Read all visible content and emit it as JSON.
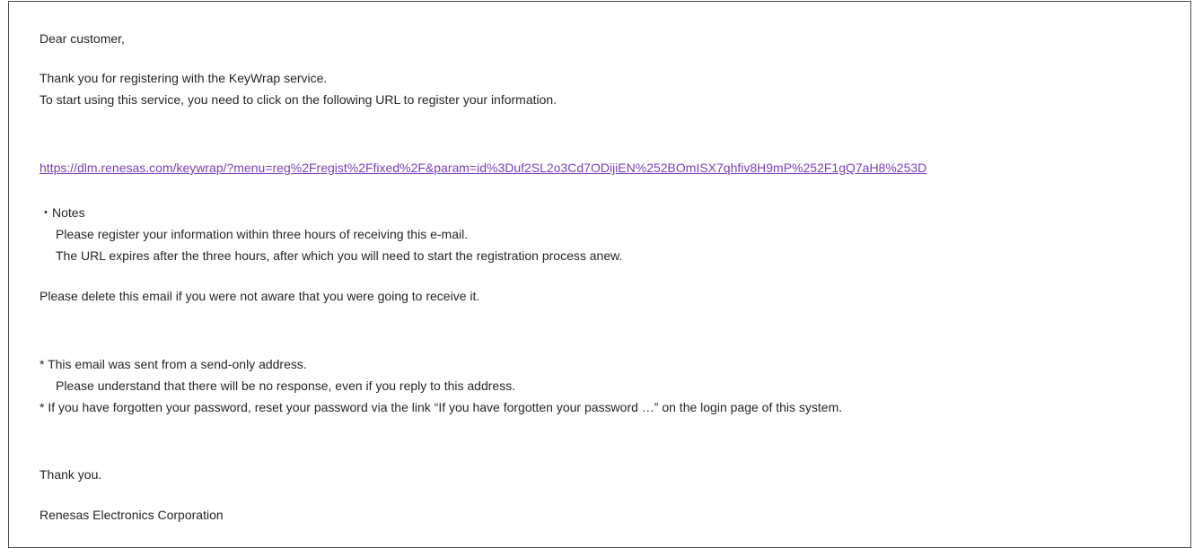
{
  "email": {
    "greeting": "Dear customer,",
    "thanks_register": "Thank you for registering with the KeyWrap service.",
    "instruction": "To start using this service, you need to click on the following URL to register your information.",
    "register_url": "https://dlm.renesas.com/keywrap/?menu=reg%2Fregist%2Ffixed%2F&param=id%3Duf2SL2o3Cd7ODijiEN%252BOmISX7qhfiv8H9mP%252F1gQ7aH8%253D",
    "notes_heading": "・Notes",
    "note_1": "Please register your information within three hours of receiving this e-mail.",
    "note_2": "The URL expires after the three hours, after which you will need to start the registration process anew.",
    "delete_notice": "Please delete this email if you were not aware that you were going to receive it.",
    "send_only_1": "* This email was sent from a send-only address.",
    "send_only_2": "Please understand that there will be no response, even if you reply to this address.",
    "password_notice": "* If you have forgotten your password, reset your password via the link “If you have forgotten your password …” on the login page of this system.",
    "closing": "Thank you.",
    "signature": "Renesas Electronics Corporation"
  },
  "colors": {
    "link": "#7b3fb8",
    "text": "#262626",
    "border": "#4d4d4d"
  }
}
